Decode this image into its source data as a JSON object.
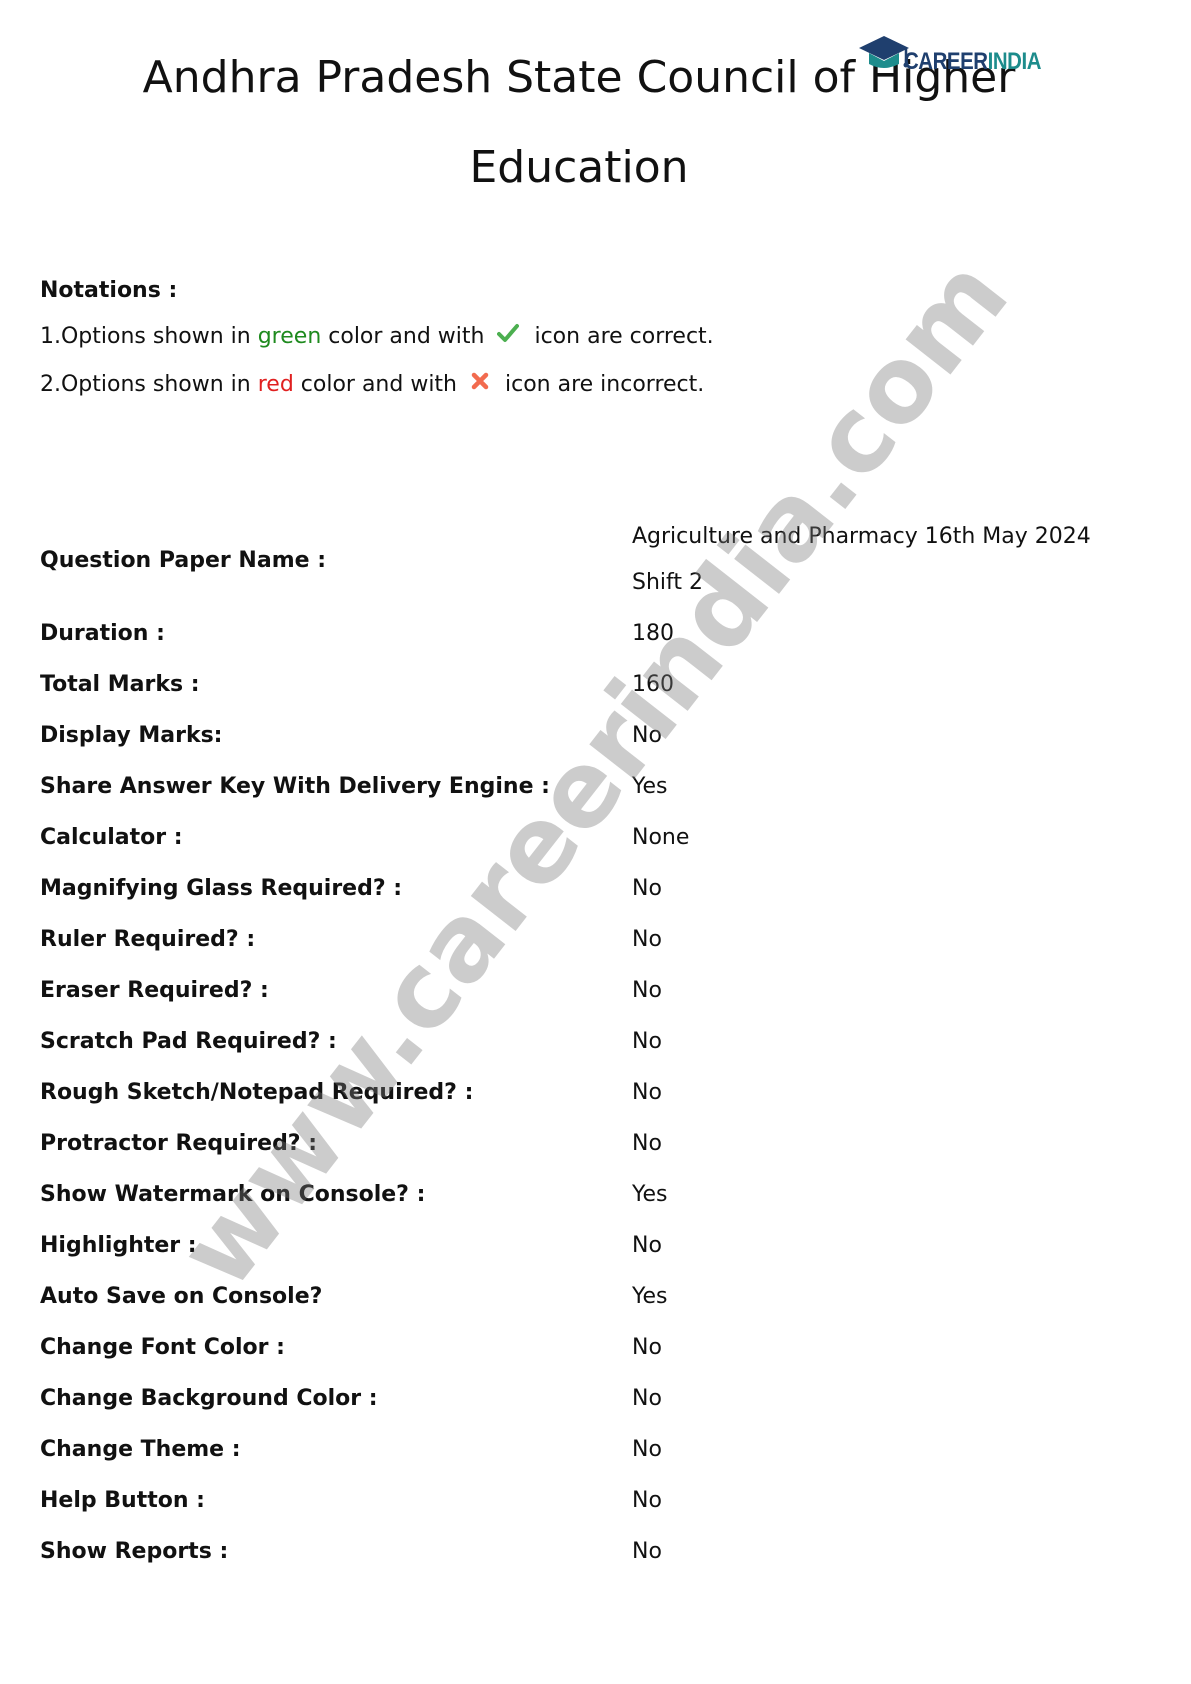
{
  "header": {
    "title_line1": "Andhra Pradesh State Council of Higher",
    "title_line2": "Education",
    "logo_text_a": "CAREER",
    "logo_text_b": "INDIA"
  },
  "notations": {
    "heading": "Notations :",
    "line1": {
      "prefix": "1.Options shown in ",
      "color_word": "green",
      "middle": " color and with ",
      "suffix": " icon are correct.",
      "icon": "check-icon"
    },
    "line2": {
      "prefix": "2.Options shown in ",
      "color_word": "red",
      "middle": " color and with ",
      "suffix": " icon are incorrect.",
      "icon": "cross-icon"
    }
  },
  "colors": {
    "green": "#1e8a1e",
    "red": "#e02020",
    "brand_blue": "#1f3f6e",
    "brand_teal": "#1d8c8c"
  },
  "details": [
    {
      "key": "Question Paper Name :",
      "value_line1": "Agriculture and Pharmacy 16th May 2024",
      "value_line2": "Shift 2"
    },
    {
      "key": "Duration :",
      "value": "180"
    },
    {
      "key": "Total Marks :",
      "value": "160"
    },
    {
      "key": "Display Marks:",
      "value": "No"
    },
    {
      "key": "Share Answer Key With Delivery Engine :",
      "value": "Yes"
    },
    {
      "key": "Calculator :",
      "value": "None"
    },
    {
      "key": "Magnifying Glass Required? :",
      "value": "No"
    },
    {
      "key": "Ruler Required? :",
      "value": "No"
    },
    {
      "key": "Eraser Required? :",
      "value": "No"
    },
    {
      "key": "Scratch Pad Required? :",
      "value": "No"
    },
    {
      "key": "Rough Sketch/Notepad Required? :",
      "value": "No"
    },
    {
      "key": "Protractor Required? :",
      "value": "No"
    },
    {
      "key": "Show Watermark on Console? :",
      "value": "Yes"
    },
    {
      "key": "Highlighter :",
      "value": "No"
    },
    {
      "key": "Auto Save on Console?",
      "value": "Yes"
    },
    {
      "key": "Change Font Color :",
      "value": "No"
    },
    {
      "key": "Change Background Color :",
      "value": "No"
    },
    {
      "key": "Change Theme :",
      "value": "No"
    },
    {
      "key": "Help Button :",
      "value": "No"
    },
    {
      "key": "Show Reports :",
      "value": "No"
    }
  ],
  "watermark": "www.careerindia.com"
}
